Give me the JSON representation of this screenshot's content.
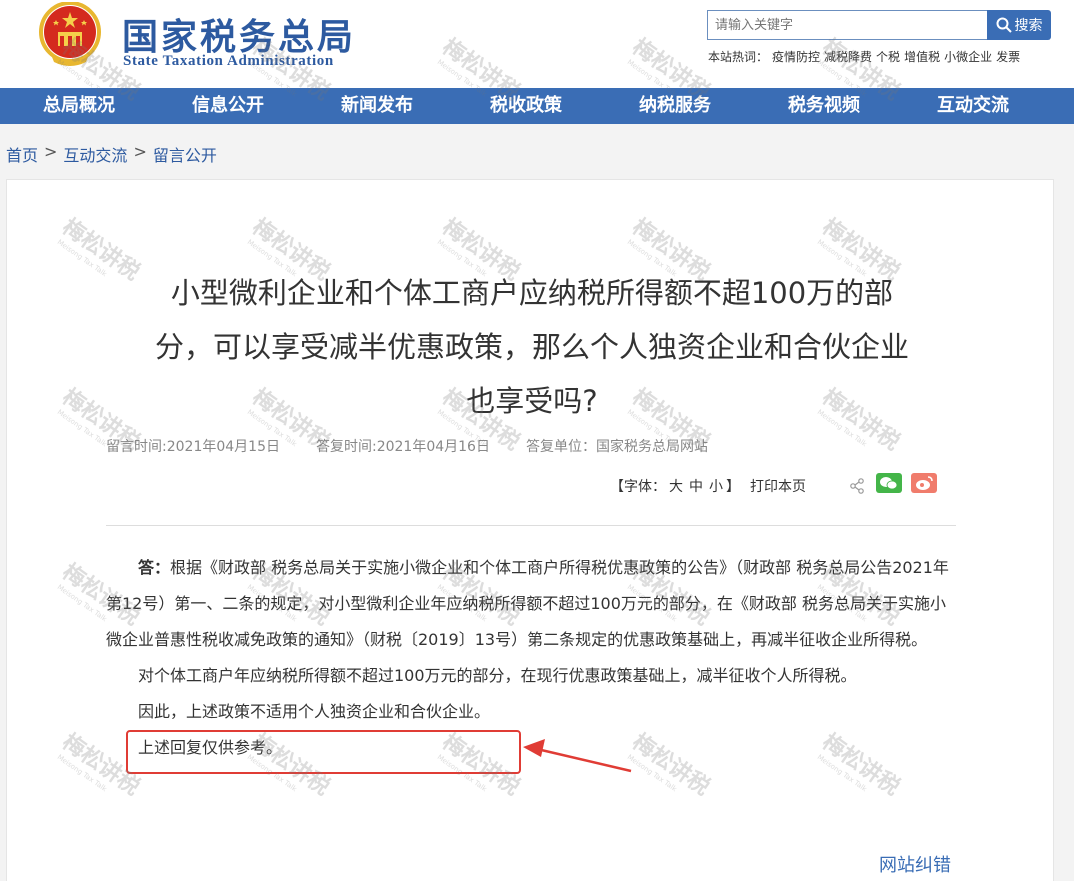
{
  "header": {
    "logo_cn": "国家税务总局",
    "logo_en": "State Taxation Administration",
    "search_placeholder": "请输入关键字",
    "search_button": "搜索",
    "hot_label": "本站热词：",
    "hot_terms": [
      "疫情防控",
      "减税降费",
      "个税",
      "增值税",
      "小微企业",
      "发票"
    ]
  },
  "nav": [
    "总局概况",
    "信息公开",
    "新闻发布",
    "税收政策",
    "纳税服务",
    "税务视频",
    "互动交流"
  ],
  "breadcrumb": [
    "首页",
    ">",
    "互动交流",
    ">",
    "留言公开"
  ],
  "article": {
    "title": "小型微利企业和个体工商户应纳税所得额不超100万的部分，可以享受减半优惠政策，那么个人独资企业和合伙企业也享受吗?",
    "meta": {
      "leave_time": "留言时间:2021年04月15日",
      "answer_time": "答复时间:2021年04月16日",
      "answer_unit": "答复单位：国家税务总局网站"
    },
    "tools": {
      "font_open": "【字体：",
      "font_large": "大",
      "font_mid": "中",
      "font_small": "小",
      "font_close": "】",
      "print": "打印本页"
    },
    "answer_label": "答：",
    "para1": "根据《财政部 税务总局关于实施小微企业和个体工商户所得税优惠政策的公告》（财政部 税务总局公告2021年第12号）第一、二条的规定，对小型微利企业年应纳税所得额不超过100万元的部分，在《财政部 税务总局关于实施小微企业普惠性税收减免政策的通知》（财税〔2019〕13号）第二条规定的优惠政策基础上，再减半征收企业所得税。",
    "para2": "对个体工商户年应纳税所得额不超过100万元的部分，在现行优惠政策基础上，减半征收个人所得税。",
    "para3": "因此，上述政策不适用个人独资企业和合伙企业。",
    "para4": "上述回复仅供参考。",
    "report_link": "网站纠错"
  },
  "watermark": {
    "text": "梅松讲税",
    "sub": "Meisong Tax Talk"
  },
  "colors": {
    "brand_blue": "#3a6db5",
    "logo_blue": "#2d5aa0",
    "highlight_red": "#e03c35",
    "wechat_green": "#44b549",
    "weibo_red": "#f07c6c"
  },
  "icons": [
    "emblem-icon",
    "search-icon",
    "share-icon",
    "wechat-icon",
    "weibo-icon",
    "arrow-icon"
  ]
}
